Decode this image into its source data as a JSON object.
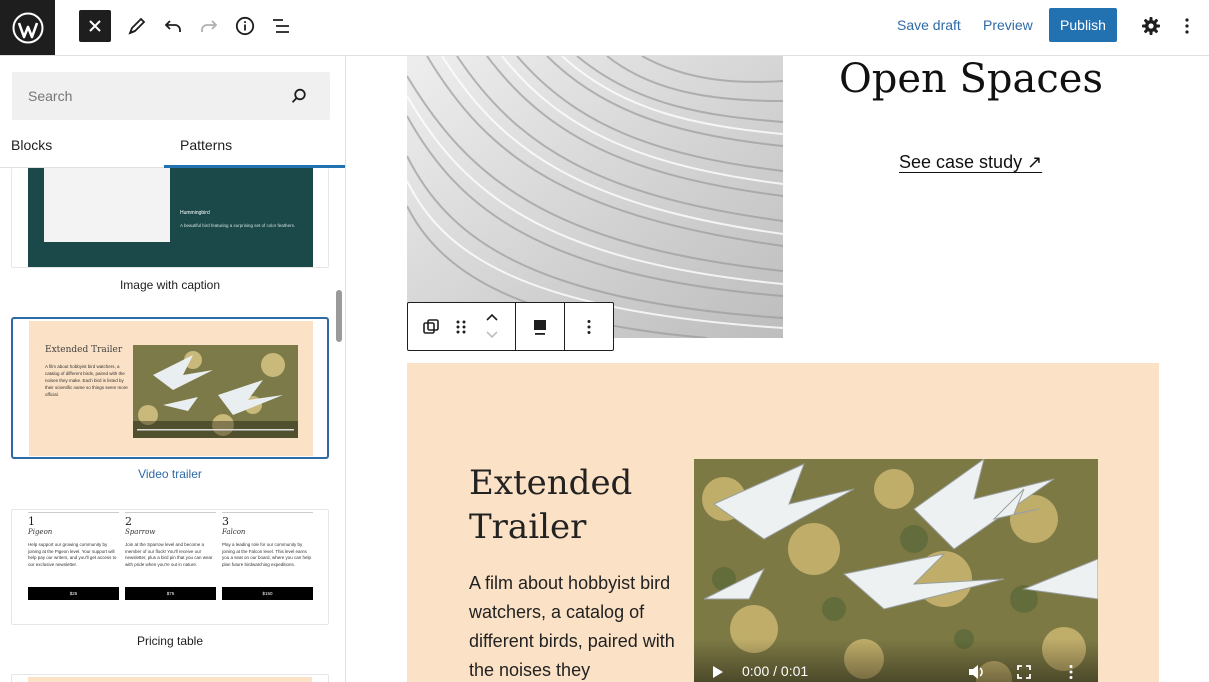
{
  "toolbar": {
    "save_draft": "Save draft",
    "preview": "Preview",
    "publish": "Publish"
  },
  "sidebar": {
    "search_placeholder": "Search",
    "tabs": [
      "Blocks",
      "Patterns"
    ],
    "active_tab": "Patterns",
    "patterns": [
      {
        "label": "Image with caption",
        "preview_title": "Hummingbird",
        "preview_text": "A beautiful bird featuring a surprising set of color feathers."
      },
      {
        "label": "Video trailer",
        "selected": true,
        "preview_title": "Extended Trailer",
        "preview_text": "A film about hobbyist bird watchers, a catalog of different birds, paired with the noises they make. Each bird is listed by their scientific name so things seem more official."
      },
      {
        "label": "Pricing table",
        "tiers": [
          {
            "num": "1",
            "name": "Pigeon",
            "text": "Help support our growing community by joining at the Pigeon level. Your support will help pay our writers, and you'll get access to our exclusive newsletter.",
            "price": "$25"
          },
          {
            "num": "2",
            "name": "Sparrow",
            "text": "Join at the Sparrow level and become a member of our flock! You'll receive our newsletter, plus a bird pin that you can wear with pride when you're out in nature.",
            "price": "$75"
          },
          {
            "num": "3",
            "name": "Falcon",
            "text": "Play a leading role for our community by joining at the Falcon level. This level earns you a seat on our board, where you can help plan future birdwatching expeditions.",
            "price": "$150"
          }
        ]
      }
    ]
  },
  "canvas": {
    "hero_title": "Open Spaces",
    "case_study_link": "See case study ↗",
    "trailer": {
      "title": "Extended Trailer",
      "description": "A film about hobbyist bird watchers, a catalog of different birds, paired with the noises they",
      "video_time": "0:00 / 0:01"
    }
  },
  "colors": {
    "accent": "#2271b1",
    "dark": "#1e1e1e",
    "peach": "#fbe1c5",
    "teal": "#1b4848"
  }
}
